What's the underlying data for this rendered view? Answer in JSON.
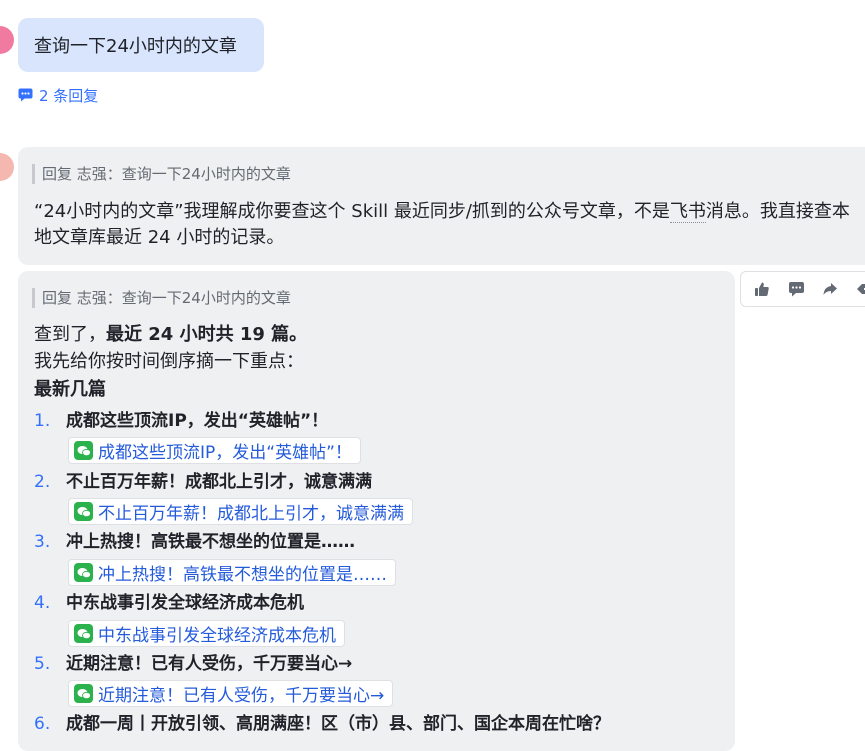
{
  "user_message": {
    "text": "查询一下24小时内的文章",
    "reply_count_label": "2 条回复"
  },
  "bot_reply_1": {
    "quote": "回复 志强：查询一下24小时内的文章",
    "text_before": "“24小时内的文章”我理解成你要查这个 Skill 最近同步/抓到的公众号文章，不是",
    "dotted_text": "飞书",
    "text_after": "消息。我直接查本地文章库最近 24 小时的记录。"
  },
  "bot_reply_2": {
    "quote": "回复 志强：查询一下24小时内的文章",
    "found_prefix": "查到了，",
    "found_bold": "最近 24 小时共 19 篇。",
    "intro": "我先给你按时间倒序摘一下重点：",
    "section_title": "最新几篇",
    "articles": [
      {
        "num": "1.",
        "title": "成都这些顶流IP，发出“英雄帖”！",
        "link": "成都这些顶流IP，发出“英雄帖”！"
      },
      {
        "num": "2.",
        "title": "不止百万年薪！成都北上引才，诚意满满",
        "link": "不止百万年薪！成都北上引才，诚意满满"
      },
      {
        "num": "3.",
        "title": "冲上热搜！高铁最不想坐的位置是……",
        "link": "冲上热搜！高铁最不想坐的位置是……"
      },
      {
        "num": "4.",
        "title": "中东战事引发全球经济成本危机",
        "link": "中东战事引发全球经济成本危机"
      },
      {
        "num": "5.",
        "title": "近期注意！已有人受伤，千万要当心→",
        "link": "近期注意！已有人受伤，千万要当心→"
      },
      {
        "num": "6.",
        "title": "成都一周丨开放引领、高朋满座！区（市）县、部门、国企本周在忙啥？",
        "link": ""
      }
    ]
  },
  "toolbar": {
    "icons": [
      "thumbs-up-icon",
      "comment-icon",
      "forward-icon",
      "more-icon"
    ]
  },
  "colors": {
    "user_bubble": "#d8e5fd",
    "bot_card": "#eff0f1",
    "link": "#245bdb",
    "accent": "#3370ff",
    "wechat_green": "#2bb24c"
  }
}
